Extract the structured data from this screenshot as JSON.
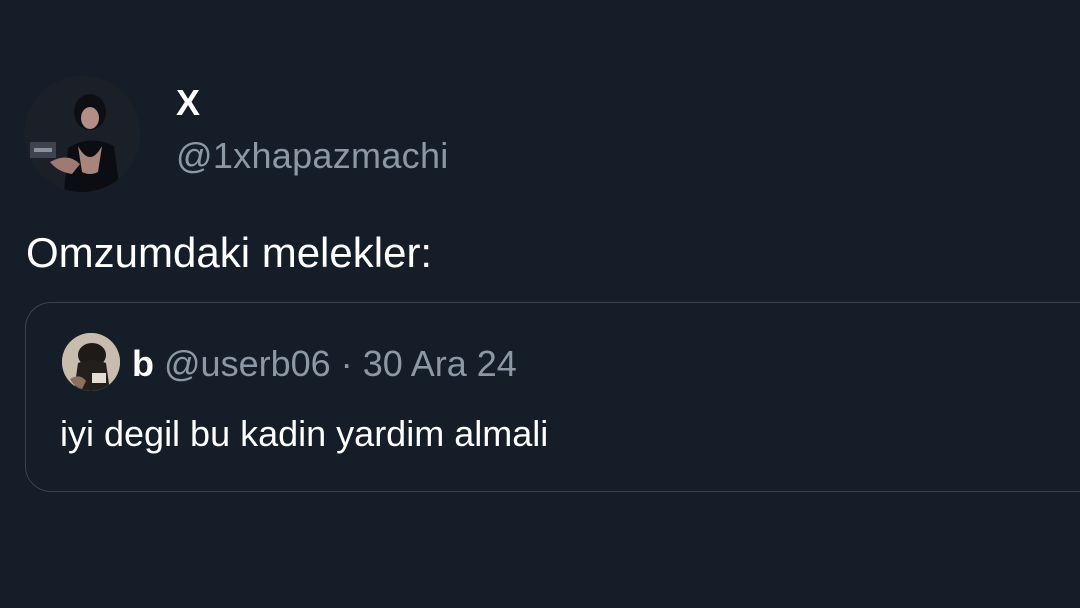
{
  "author": {
    "display_name": "X",
    "handle": "@1xhapazmachi"
  },
  "tweet": {
    "text": "Omzumdaki melekler:"
  },
  "quoted": {
    "display_name": "b",
    "handle": "@userb06",
    "separator": "·",
    "date": "30 Ara 24",
    "text": "iyi degil bu kadin yardim almali"
  },
  "colors": {
    "background": "#151d28",
    "primary_text": "#ffffff",
    "secondary_text": "#8b98a5",
    "border": "#38444d"
  }
}
